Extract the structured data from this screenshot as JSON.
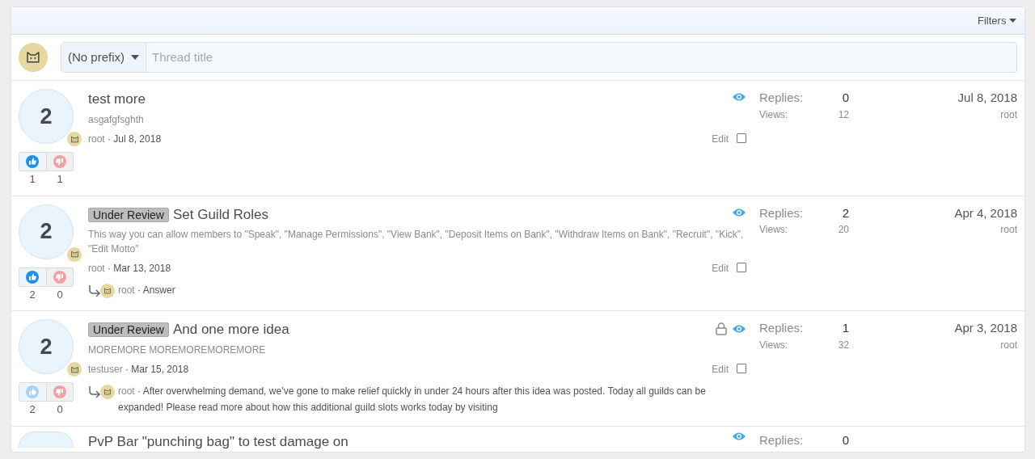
{
  "filters": {
    "label": "Filters"
  },
  "new_thread": {
    "prefix": "(No prefix)",
    "placeholder": "Thread title"
  },
  "threads": [
    {
      "score": "2",
      "title": "test more",
      "snippet": "asgafgfsghth",
      "author": "root",
      "date": "· Jul 8, 2018",
      "locked": false,
      "watched": true,
      "edit": "Edit",
      "checked": false,
      "upvoted": true,
      "up_count": "1",
      "down_count": "1",
      "replies_label": "Replies:",
      "replies": "0",
      "views_label": "Views:",
      "views": "12",
      "last_date": "Jul 8, 2018",
      "last_user": "root"
    },
    {
      "score": "2",
      "prefix": "Under Review",
      "title": "Set Guild Roles",
      "snippet": "This way you can allow members to \"Speak\", \"Manage Permissions\", \"View Bank\", \"Deposit Items on Bank\", \"Withdraw Items on Bank\", \"Recruit\", \"Kick\", \"Edit Motto\"",
      "author": "root",
      "date": "· Mar 13, 2018",
      "locked": false,
      "watched": true,
      "edit": "Edit",
      "checked": false,
      "upvoted": true,
      "up_count": "2",
      "down_count": "0",
      "answer": {
        "author": "root",
        "text": "· Answer"
      },
      "replies_label": "Replies:",
      "replies": "2",
      "views_label": "Views:",
      "views": "20",
      "last_date": "Apr 4, 2018",
      "last_user": "root"
    },
    {
      "score": "2",
      "prefix": "Under Review",
      "title": "And one more idea",
      "snippet": "MOREMORE MOREMOREMOREMORE",
      "author": "testuser",
      "date": "· Mar 15, 2018",
      "locked": true,
      "watched": true,
      "edit": "Edit",
      "checked": false,
      "upvoted": false,
      "up_count": "2",
      "down_count": "0",
      "answer": {
        "author": "root",
        "text": "· After overwhelming demand, we’ve gone to make relief quickly in under 24 hours after this idea was posted. Today all guilds can be expanded! Please read more about how this additional guild slots works today by visiting"
      },
      "replies_label": "Replies:",
      "replies": "1",
      "views_label": "Views:",
      "views": "32",
      "last_date": "Apr 3, 2018",
      "last_user": "root"
    }
  ],
  "partial_thread": {
    "title": "PvP Bar \"punching bag\" to test damage on",
    "watched": true,
    "replies_label": "Replies:",
    "replies": "0"
  }
}
